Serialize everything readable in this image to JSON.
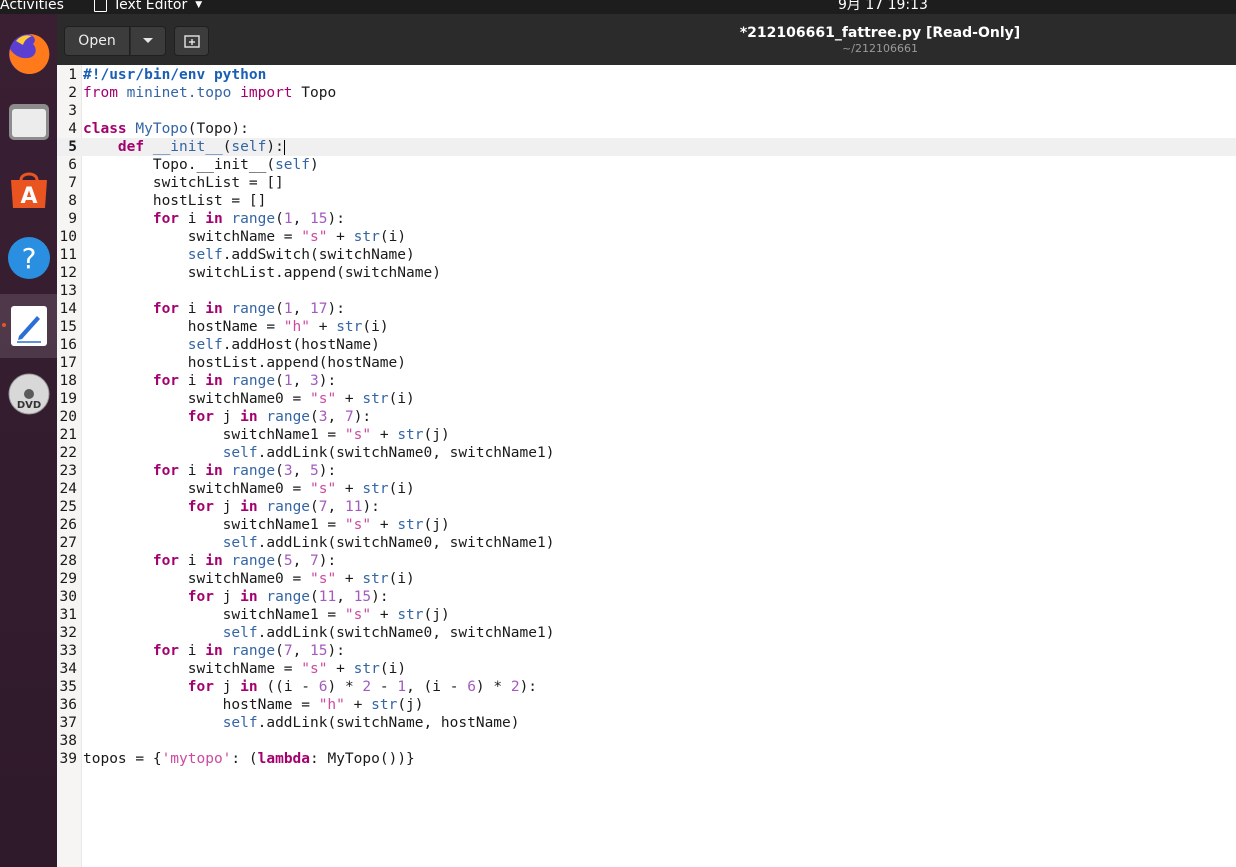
{
  "topbar": {
    "activities": "Activities",
    "app_name": "Text Editor",
    "clock": "9月 17  19:13"
  },
  "dock": {
    "items": [
      {
        "name": "firefox-icon"
      },
      {
        "name": "files-icon"
      },
      {
        "name": "software-icon"
      },
      {
        "name": "help-icon"
      },
      {
        "name": "text-editor-icon",
        "active": true
      },
      {
        "name": "dvd-icon"
      }
    ]
  },
  "header": {
    "open_label": "Open",
    "title": "*212106661_fattree.py [Read-Only]",
    "subtitle": "~/212106661"
  },
  "colors": {
    "keyword": "#a4006e",
    "builtin": "#3465a4",
    "string": "#cc4aa0",
    "number": "#a35bbd",
    "shebang": "#1a5fb4",
    "topbar": "#1d1d1d",
    "headerbar": "#2b2b2b"
  },
  "editor": {
    "current_line": 5,
    "lines": [
      {
        "n": "1",
        "t": [
          [
            "sh",
            "#!/usr/bin/env python"
          ]
        ]
      },
      {
        "n": "2",
        "t": [
          [
            "kw2",
            "from "
          ],
          [
            "bi",
            "mininet.topo"
          ],
          [
            "kw2",
            " import "
          ],
          [
            "",
            "Topo"
          ]
        ]
      },
      {
        "n": "3",
        "t": []
      },
      {
        "n": "4",
        "t": [
          [
            "kw",
            "class "
          ],
          [
            "bi",
            "MyTopo"
          ],
          [
            "",
            "(Topo):"
          ]
        ]
      },
      {
        "n": "5",
        "t": [
          [
            "",
            "    "
          ],
          [
            "kw",
            "def "
          ],
          [
            "bi",
            "__init__"
          ],
          [
            "",
            "("
          ],
          [
            "bi",
            "self"
          ],
          [
            "",
            "):"
          ]
        ]
      },
      {
        "n": "6",
        "t": [
          [
            "",
            "        Topo.__init__("
          ],
          [
            "bi",
            "self"
          ],
          [
            "",
            ")"
          ]
        ]
      },
      {
        "n": "7",
        "t": [
          [
            "",
            "        switchList = []"
          ]
        ]
      },
      {
        "n": "8",
        "t": [
          [
            "",
            "        hostList = []"
          ]
        ]
      },
      {
        "n": "9",
        "t": [
          [
            "",
            "        "
          ],
          [
            "kw",
            "for"
          ],
          [
            "",
            " i "
          ],
          [
            "kw",
            "in"
          ],
          [
            "",
            " "
          ],
          [
            "bi",
            "range"
          ],
          [
            "",
            "("
          ],
          [
            "nm",
            "1"
          ],
          [
            "",
            ", "
          ],
          [
            "nm",
            "15"
          ],
          [
            "",
            "):"
          ]
        ]
      },
      {
        "n": "10",
        "t": [
          [
            "",
            "            switchName = "
          ],
          [
            "st",
            "\"s\""
          ],
          [
            "",
            " + "
          ],
          [
            "bi",
            "str"
          ],
          [
            "",
            "(i)"
          ]
        ]
      },
      {
        "n": "11",
        "t": [
          [
            "",
            "            "
          ],
          [
            "bi",
            "self"
          ],
          [
            "",
            ".addSwitch(switchName)"
          ]
        ]
      },
      {
        "n": "12",
        "t": [
          [
            "",
            "            switchList.append(switchName)"
          ]
        ]
      },
      {
        "n": "13",
        "t": []
      },
      {
        "n": "14",
        "t": [
          [
            "",
            "        "
          ],
          [
            "kw",
            "for"
          ],
          [
            "",
            " i "
          ],
          [
            "kw",
            "in"
          ],
          [
            "",
            " "
          ],
          [
            "bi",
            "range"
          ],
          [
            "",
            "("
          ],
          [
            "nm",
            "1"
          ],
          [
            "",
            ", "
          ],
          [
            "nm",
            "17"
          ],
          [
            "",
            "):"
          ]
        ]
      },
      {
        "n": "15",
        "t": [
          [
            "",
            "            hostName = "
          ],
          [
            "st",
            "\"h\""
          ],
          [
            "",
            " + "
          ],
          [
            "bi",
            "str"
          ],
          [
            "",
            "(i)"
          ]
        ]
      },
      {
        "n": "16",
        "t": [
          [
            "",
            "            "
          ],
          [
            "bi",
            "self"
          ],
          [
            "",
            ".addHost(hostName)"
          ]
        ]
      },
      {
        "n": "17",
        "t": [
          [
            "",
            "            hostList.append(hostName)"
          ]
        ]
      },
      {
        "n": "18",
        "t": [
          [
            "",
            "        "
          ],
          [
            "kw",
            "for"
          ],
          [
            "",
            " i "
          ],
          [
            "kw",
            "in"
          ],
          [
            "",
            " "
          ],
          [
            "bi",
            "range"
          ],
          [
            "",
            "("
          ],
          [
            "nm",
            "1"
          ],
          [
            "",
            ", "
          ],
          [
            "nm",
            "3"
          ],
          [
            "",
            "):"
          ]
        ]
      },
      {
        "n": "19",
        "t": [
          [
            "",
            "            switchName0 = "
          ],
          [
            "st",
            "\"s\""
          ],
          [
            "",
            " + "
          ],
          [
            "bi",
            "str"
          ],
          [
            "",
            "(i)"
          ]
        ]
      },
      {
        "n": "20",
        "t": [
          [
            "",
            "            "
          ],
          [
            "kw",
            "for"
          ],
          [
            "",
            " j "
          ],
          [
            "kw",
            "in"
          ],
          [
            "",
            " "
          ],
          [
            "bi",
            "range"
          ],
          [
            "",
            "("
          ],
          [
            "nm",
            "3"
          ],
          [
            "",
            ", "
          ],
          [
            "nm",
            "7"
          ],
          [
            "",
            "):"
          ]
        ]
      },
      {
        "n": "21",
        "t": [
          [
            "",
            "                switchName1 = "
          ],
          [
            "st",
            "\"s\""
          ],
          [
            "",
            " + "
          ],
          [
            "bi",
            "str"
          ],
          [
            "",
            "(j)"
          ]
        ]
      },
      {
        "n": "22",
        "t": [
          [
            "",
            "                "
          ],
          [
            "bi",
            "self"
          ],
          [
            "",
            ".addLink(switchName0, switchName1)"
          ]
        ]
      },
      {
        "n": "23",
        "t": [
          [
            "",
            "        "
          ],
          [
            "kw",
            "for"
          ],
          [
            "",
            " i "
          ],
          [
            "kw",
            "in"
          ],
          [
            "",
            " "
          ],
          [
            "bi",
            "range"
          ],
          [
            "",
            "("
          ],
          [
            "nm",
            "3"
          ],
          [
            "",
            ", "
          ],
          [
            "nm",
            "5"
          ],
          [
            "",
            "):"
          ]
        ]
      },
      {
        "n": "24",
        "t": [
          [
            "",
            "            switchName0 = "
          ],
          [
            "st",
            "\"s\""
          ],
          [
            "",
            " + "
          ],
          [
            "bi",
            "str"
          ],
          [
            "",
            "(i)"
          ]
        ]
      },
      {
        "n": "25",
        "t": [
          [
            "",
            "            "
          ],
          [
            "kw",
            "for"
          ],
          [
            "",
            " j "
          ],
          [
            "kw",
            "in"
          ],
          [
            "",
            " "
          ],
          [
            "bi",
            "range"
          ],
          [
            "",
            "("
          ],
          [
            "nm",
            "7"
          ],
          [
            "",
            ", "
          ],
          [
            "nm",
            "11"
          ],
          [
            "",
            "):"
          ]
        ]
      },
      {
        "n": "26",
        "t": [
          [
            "",
            "                switchName1 = "
          ],
          [
            "st",
            "\"s\""
          ],
          [
            "",
            " + "
          ],
          [
            "bi",
            "str"
          ],
          [
            "",
            "(j)"
          ]
        ]
      },
      {
        "n": "27",
        "t": [
          [
            "",
            "                "
          ],
          [
            "bi",
            "self"
          ],
          [
            "",
            ".addLink(switchName0, switchName1)"
          ]
        ]
      },
      {
        "n": "28",
        "t": [
          [
            "",
            "        "
          ],
          [
            "kw",
            "for"
          ],
          [
            "",
            " i "
          ],
          [
            "kw",
            "in"
          ],
          [
            "",
            " "
          ],
          [
            "bi",
            "range"
          ],
          [
            "",
            "("
          ],
          [
            "nm",
            "5"
          ],
          [
            "",
            ", "
          ],
          [
            "nm",
            "7"
          ],
          [
            "",
            "):"
          ]
        ]
      },
      {
        "n": "29",
        "t": [
          [
            "",
            "            switchName0 = "
          ],
          [
            "st",
            "\"s\""
          ],
          [
            "",
            " + "
          ],
          [
            "bi",
            "str"
          ],
          [
            "",
            "(i)"
          ]
        ]
      },
      {
        "n": "30",
        "t": [
          [
            "",
            "            "
          ],
          [
            "kw",
            "for"
          ],
          [
            "",
            " j "
          ],
          [
            "kw",
            "in"
          ],
          [
            "",
            " "
          ],
          [
            "bi",
            "range"
          ],
          [
            "",
            "("
          ],
          [
            "nm",
            "11"
          ],
          [
            "",
            ", "
          ],
          [
            "nm",
            "15"
          ],
          [
            "",
            "):"
          ]
        ]
      },
      {
        "n": "31",
        "t": [
          [
            "",
            "                switchName1 = "
          ],
          [
            "st",
            "\"s\""
          ],
          [
            "",
            " + "
          ],
          [
            "bi",
            "str"
          ],
          [
            "",
            "(j)"
          ]
        ]
      },
      {
        "n": "32",
        "t": [
          [
            "",
            "                "
          ],
          [
            "bi",
            "self"
          ],
          [
            "",
            ".addLink(switchName0, switchName1)"
          ]
        ]
      },
      {
        "n": "33",
        "t": [
          [
            "",
            "        "
          ],
          [
            "kw",
            "for"
          ],
          [
            "",
            " i "
          ],
          [
            "kw",
            "in"
          ],
          [
            "",
            " "
          ],
          [
            "bi",
            "range"
          ],
          [
            "",
            "("
          ],
          [
            "nm",
            "7"
          ],
          [
            "",
            ", "
          ],
          [
            "nm",
            "15"
          ],
          [
            "",
            "):"
          ]
        ]
      },
      {
        "n": "34",
        "t": [
          [
            "",
            "            switchName = "
          ],
          [
            "st",
            "\"s\""
          ],
          [
            "",
            " + "
          ],
          [
            "bi",
            "str"
          ],
          [
            "",
            "(i)"
          ]
        ]
      },
      {
        "n": "35",
        "t": [
          [
            "",
            "            "
          ],
          [
            "kw",
            "for"
          ],
          [
            "",
            " j "
          ],
          [
            "kw",
            "in"
          ],
          [
            "",
            " ((i - "
          ],
          [
            "nm",
            "6"
          ],
          [
            "",
            ") * "
          ],
          [
            "nm",
            "2"
          ],
          [
            "",
            " - "
          ],
          [
            "nm",
            "1"
          ],
          [
            "",
            ", (i - "
          ],
          [
            "nm",
            "6"
          ],
          [
            "",
            ") * "
          ],
          [
            "nm",
            "2"
          ],
          [
            "",
            "):"
          ]
        ]
      },
      {
        "n": "36",
        "t": [
          [
            "",
            "                hostName = "
          ],
          [
            "st",
            "\"h\""
          ],
          [
            "",
            " + "
          ],
          [
            "bi",
            "str"
          ],
          [
            "",
            "(j)"
          ]
        ]
      },
      {
        "n": "37",
        "t": [
          [
            "",
            "                "
          ],
          [
            "bi",
            "self"
          ],
          [
            "",
            ".addLink(switchName, hostName)"
          ]
        ]
      },
      {
        "n": "38",
        "t": []
      },
      {
        "n": "39",
        "t": [
          [
            "",
            "topos = {"
          ],
          [
            "st",
            "'mytopo'"
          ],
          [
            "",
            ": ("
          ],
          [
            "kw",
            "lambda"
          ],
          [
            "",
            ": MyTopo())}"
          ]
        ]
      }
    ]
  }
}
